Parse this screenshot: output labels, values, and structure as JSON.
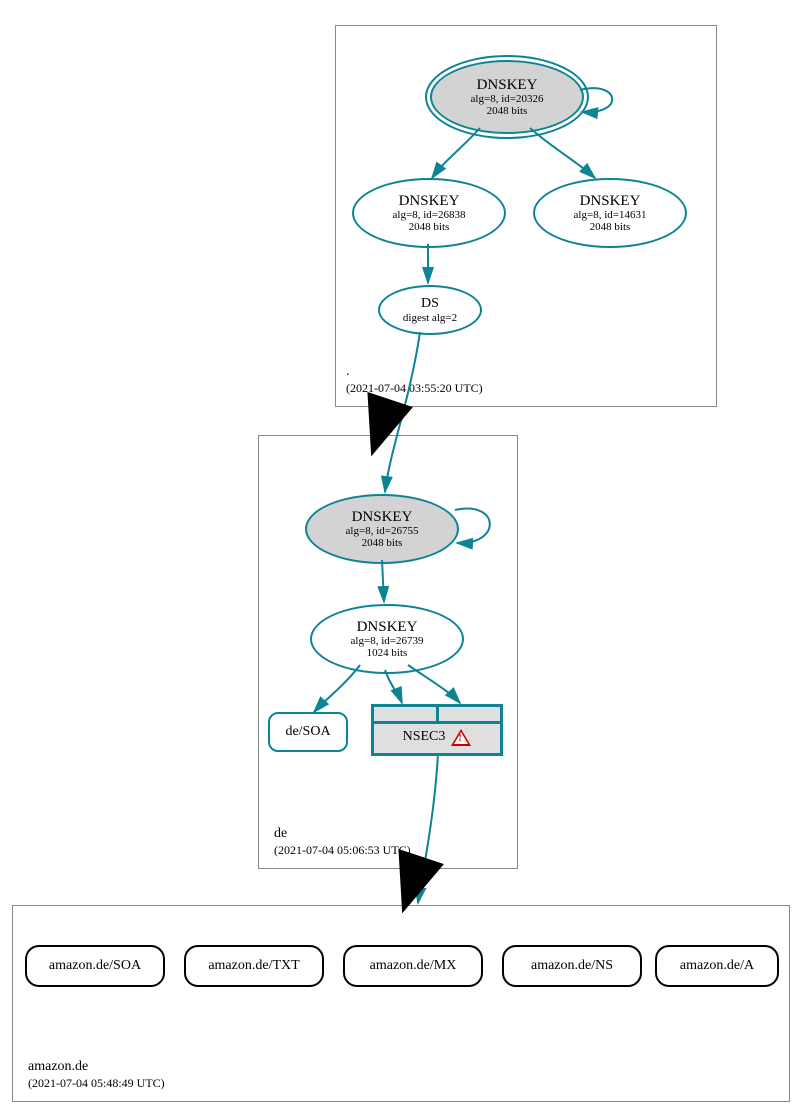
{
  "zones": {
    "root": {
      "name": ".",
      "timestamp": "(2021-07-04 03:55:20 UTC)"
    },
    "de": {
      "name": "de",
      "timestamp": "(2021-07-04 05:06:53 UTC)"
    },
    "amazon": {
      "name": "amazon.de",
      "timestamp": "(2021-07-04 05:48:49 UTC)"
    }
  },
  "nodes": {
    "root_ksk": {
      "title": "DNSKEY",
      "l1": "alg=8, id=20326",
      "l2": "2048 bits"
    },
    "root_zsk1": {
      "title": "DNSKEY",
      "l1": "alg=8, id=26838",
      "l2": "2048 bits"
    },
    "root_zsk2": {
      "title": "DNSKEY",
      "l1": "alg=8, id=14631",
      "l2": "2048 bits"
    },
    "ds": {
      "title": "DS",
      "l1": "digest alg=2"
    },
    "de_ksk": {
      "title": "DNSKEY",
      "l1": "alg=8, id=26755",
      "l2": "2048 bits"
    },
    "de_zsk": {
      "title": "DNSKEY",
      "l1": "alg=8, id=26739",
      "l2": "1024 bits"
    },
    "de_soa": "de/SOA",
    "nsec3": "NSEC3"
  },
  "records": {
    "soa": "amazon.de/SOA",
    "txt": "amazon.de/TXT",
    "mx": "amazon.de/MX",
    "ns": "amazon.de/NS",
    "a": "amazon.de/A"
  }
}
